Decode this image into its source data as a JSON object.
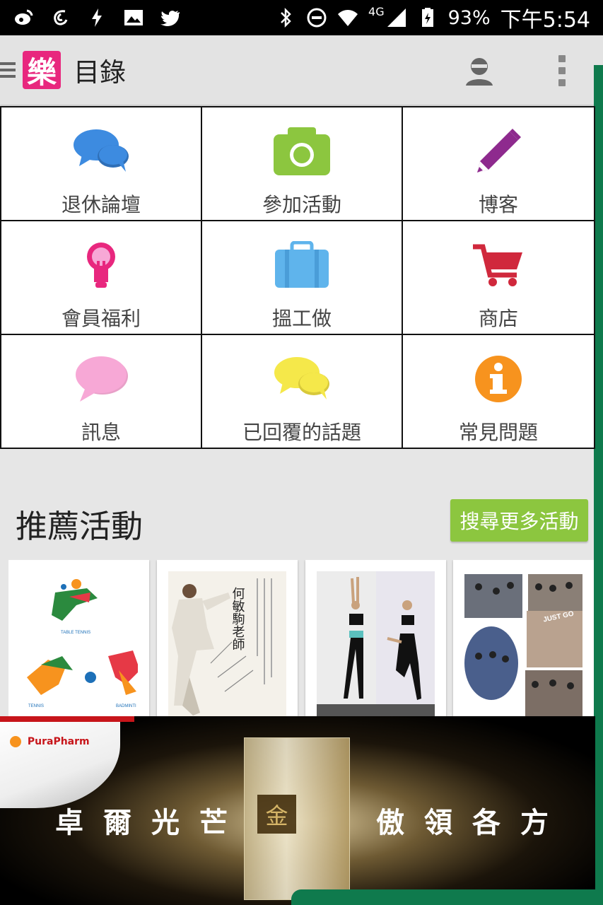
{
  "status_bar": {
    "battery": "93%",
    "time": "下午5:54",
    "network": "4G",
    "icons": [
      "weibo-icon",
      "app-icon",
      "flash-icon",
      "image-icon",
      "twitter-icon",
      "bluetooth-icon",
      "dnd-icon",
      "wifi-icon",
      "signal-icon",
      "battery-icon"
    ]
  },
  "app_bar": {
    "logo_text": "樂",
    "title": "目錄"
  },
  "grid": {
    "items": [
      {
        "label": "退休論壇",
        "icon": "chat-bubbles-icon",
        "color": "#3d8be0"
      },
      {
        "label": "參加活動",
        "icon": "camera-icon",
        "color": "#8cc63f"
      },
      {
        "label": "博客",
        "icon": "pencil-icon",
        "color": "#8e2a8e"
      },
      {
        "label": "會員福利",
        "icon": "lightbulb-icon",
        "color": "#e8277e"
      },
      {
        "label": "搵工做",
        "icon": "briefcase-icon",
        "color": "#5fb4ec"
      },
      {
        "label": "商店",
        "icon": "shopping-cart-icon",
        "color": "#d0283c"
      },
      {
        "label": "訊息",
        "icon": "speech-bubble-icon",
        "color": "#f7a8d6"
      },
      {
        "label": "已回覆的話題",
        "icon": "yellow-chat-bubbles-icon",
        "color": "#f5e84a"
      },
      {
        "label": "常見問題",
        "icon": "info-icon",
        "color": "#f7931e"
      }
    ]
  },
  "recommended": {
    "title": "推薦活動",
    "more_button": "搜尋更多活動"
  },
  "cards": [
    {
      "name": "sports-card",
      "labels": [
        "TABLE TENNIS",
        "TENNIS",
        "BADMINTI"
      ]
    },
    {
      "name": "taichi-card",
      "labels": [
        "何敏駒老師"
      ]
    },
    {
      "name": "fitness-card",
      "labels": []
    },
    {
      "name": "group-photo-card",
      "labels": [
        "JUST GO"
      ]
    }
  ],
  "ad": {
    "brand": "PuraPharm",
    "text_left": "卓爾光芒",
    "text_right": "傲領各方",
    "box_logo": "金"
  }
}
